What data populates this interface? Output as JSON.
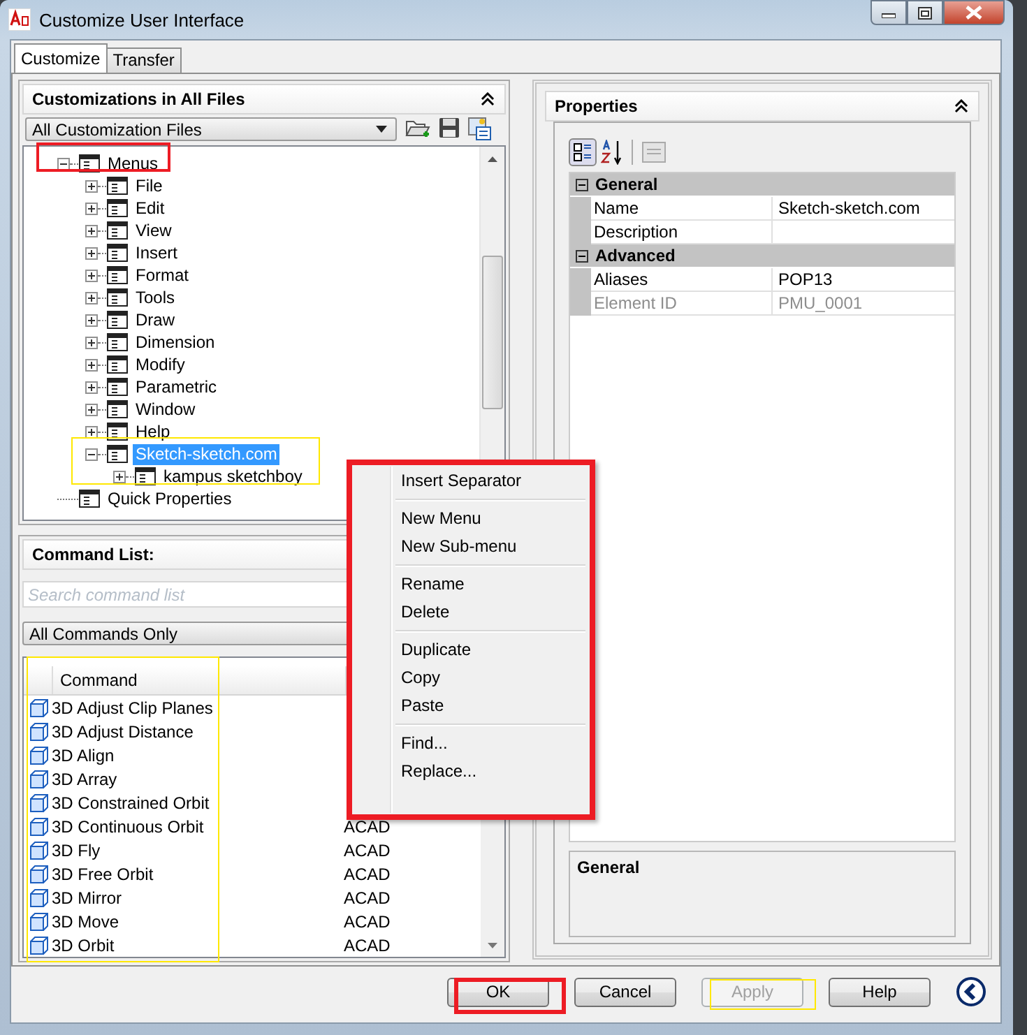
{
  "window": {
    "title": "Customize User Interface"
  },
  "tabs": [
    {
      "label": "Customize",
      "selected": true
    },
    {
      "label": "Transfer",
      "selected": false
    }
  ],
  "customizations_panel": {
    "title": "Customizations in All Files",
    "file_filter": "All Customization Files",
    "tree": [
      {
        "label": "Menus",
        "expanded": true,
        "selected": false,
        "children": [
          {
            "label": "File",
            "expanded": false,
            "selected": false
          },
          {
            "label": "Edit",
            "expanded": false,
            "selected": false
          },
          {
            "label": "View",
            "expanded": false,
            "selected": false
          },
          {
            "label": "Insert",
            "expanded": false,
            "selected": false
          },
          {
            "label": "Format",
            "expanded": false,
            "selected": false
          },
          {
            "label": "Tools",
            "expanded": false,
            "selected": false
          },
          {
            "label": "Draw",
            "expanded": false,
            "selected": false
          },
          {
            "label": "Dimension",
            "expanded": false,
            "selected": false
          },
          {
            "label": "Modify",
            "expanded": false,
            "selected": false
          },
          {
            "label": "Parametric",
            "expanded": false,
            "selected": false
          },
          {
            "label": "Window",
            "expanded": false,
            "selected": false
          },
          {
            "label": "Help",
            "expanded": false,
            "selected": false
          },
          {
            "label": "Sketch-sketch.com",
            "expanded": true,
            "selected": true,
            "children": [
              {
                "label": "kampus sketchboy",
                "expanded": false,
                "selected": false
              }
            ]
          }
        ]
      },
      {
        "label": "Quick Properties",
        "selected": false
      }
    ]
  },
  "command_list_panel": {
    "title": "Command List:",
    "search": {
      "placeholder": "Search command list"
    },
    "filter": "All Commands Only",
    "columns": [
      "Command"
    ],
    "rows": [
      {
        "command": "3D Adjust Clip Planes"
      },
      {
        "command": "3D Adjust Distance"
      },
      {
        "command": "3D Align"
      },
      {
        "command": "3D Array"
      },
      {
        "command": "3D Constrained Orbit"
      },
      {
        "command": "3D Continuous Orbit",
        "source": "ACAD"
      },
      {
        "command": "3D Fly",
        "source": "ACAD"
      },
      {
        "command": "3D Free Orbit",
        "source": "ACAD"
      },
      {
        "command": "3D Mirror",
        "source": "ACAD"
      },
      {
        "command": "3D Move",
        "source": "ACAD"
      },
      {
        "command": "3D Orbit",
        "source": "ACAD"
      }
    ]
  },
  "properties_panel": {
    "title": "Properties",
    "categories": [
      {
        "name": "General",
        "expanded": true,
        "rows": [
          {
            "name": "Name",
            "value": "Sketch-sketch.com",
            "disabled": false
          },
          {
            "name": "Description",
            "disabled": false
          }
        ]
      },
      {
        "name": "Advanced",
        "expanded": true,
        "rows": [
          {
            "name": "Aliases",
            "value": "POP13",
            "disabled": false
          },
          {
            "name": "Element ID",
            "value": "PMU_0001",
            "disabled": true
          }
        ]
      }
    ],
    "description_title": "General"
  },
  "context_menu": [
    [
      "Insert Separator"
    ],
    [
      "New Menu",
      "New Sub-menu"
    ],
    [
      "Rename",
      "Delete"
    ],
    [
      "Duplicate",
      "Copy",
      "Paste"
    ],
    [
      "Find...",
      "Replace..."
    ]
  ],
  "buttons": [
    {
      "label": "OK",
      "disabled": false
    },
    {
      "label": "Cancel",
      "disabled": false
    },
    {
      "label": "Apply",
      "disabled": true
    },
    {
      "label": "Help",
      "disabled": false
    }
  ],
  "annotation_frames": [
    {
      "color": "#ed1c24"
    },
    {
      "color": "#ed1c24"
    },
    {
      "color": "#ffe800"
    },
    {
      "color": "#ffe800"
    },
    {
      "color": "#ffe800"
    }
  ]
}
